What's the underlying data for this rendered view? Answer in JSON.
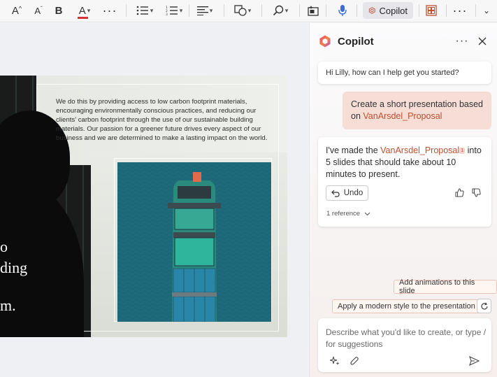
{
  "toolbar": {
    "copilot_label": "Copilot"
  },
  "slide": {
    "body_text": "We do this by providing access to low carbon footprint materials, encouraging environmentally conscious practices, and reducing our clients' carbon footprint through the use of our sustainable building materials. Our passion for a greener future drives every aspect of our business and we are determined to make a lasting impact on the world.",
    "heading_line1": "o",
    "heading_line2": "ding",
    "heading_line3": "m."
  },
  "copilot": {
    "title": "Copilot",
    "greeting": "Hi Lilly, how can I help get you started?",
    "user_message_prefix": "Create a short presentation based on ",
    "user_message_link": "VanArsdel_Proposal",
    "reply_prefix": "I've made the ",
    "reply_link": "VanArsdel_Proposal",
    "reply_ref_number": "1",
    "reply_suffix": " into 5 slides that should take about 10 minutes to present.",
    "undo_label": "Undo",
    "reference_label": "1 reference",
    "suggestions": [
      "Add animations to this slide",
      "Apply a modern style to the presentation"
    ],
    "compose_placeholder": "Describe what you'd like to create, or type / for suggestions"
  },
  "colors": {
    "accent": "#c24f2e",
    "user_bubble": "#f6ddd6",
    "font_color_underline": "#d13438"
  }
}
